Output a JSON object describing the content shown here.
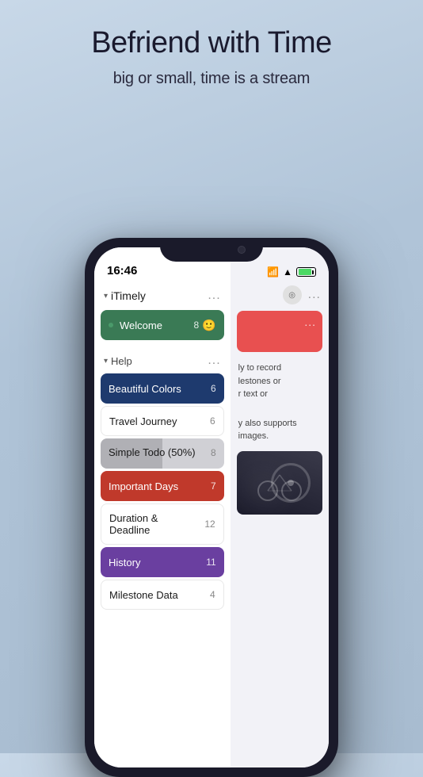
{
  "background": {
    "gradient_start": "#c8d8e8",
    "gradient_end": "#a8bcd0"
  },
  "headline": {
    "main": "Befriend with Time",
    "sub": "big or small, time is a stream"
  },
  "status_bar": {
    "time": "16:46",
    "wifi": "wifi",
    "battery": "battery",
    "signal": "signal"
  },
  "left_panel": {
    "section_itimely": {
      "title": "iTimely",
      "dots": "...",
      "items": [
        {
          "id": "welcome",
          "label": "Welcome",
          "count": "8",
          "bg_color": "#3a7a55",
          "has_dot": true,
          "has_emoji": true,
          "emoji": "🙂",
          "text_dark": false
        }
      ]
    },
    "section_help": {
      "title": "Help",
      "dots": "...",
      "items": [
        {
          "id": "beautiful-colors",
          "label": "Beautiful Colors",
          "count": "6",
          "bg_color": "#1e3a6e",
          "text_dark": false
        },
        {
          "id": "travel-journey",
          "label": "Travel Journey",
          "count": "6",
          "bg_color": null,
          "text_dark": true
        },
        {
          "id": "simple-todo",
          "label": "Simple Todo (50%)",
          "count": "8",
          "bg_color": "#c0c0c5",
          "text_dark": true,
          "is_progress": true,
          "progress_pct": 50
        },
        {
          "id": "important-days",
          "label": "Important Days",
          "count": "7",
          "bg_color": "#c0392b",
          "text_dark": false
        },
        {
          "id": "duration-deadline",
          "label": "Duration & Deadline",
          "count": "12",
          "bg_color": null,
          "text_dark": true
        },
        {
          "id": "history",
          "label": "History",
          "count": "11",
          "bg_color": "#6a3fa0",
          "text_dark": false
        },
        {
          "id": "milestone-data",
          "label": "Milestone Data",
          "count": "4",
          "bg_color": null,
          "text_dark": true
        }
      ]
    }
  },
  "right_panel": {
    "icon_label": "◎",
    "dots": "...",
    "red_block_dots": "...",
    "text_lines_1": [
      "ly to record",
      "lestones or",
      "r text or"
    ],
    "text_lines_2": [
      "also supports",
      "images."
    ]
  }
}
